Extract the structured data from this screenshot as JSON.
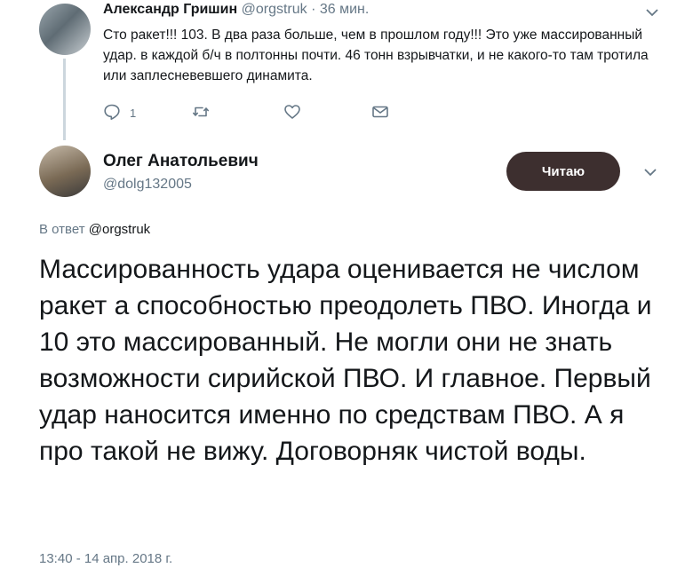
{
  "tweet1": {
    "author_name": "Александр Гришин",
    "handle": "@orgstruk",
    "separator": "·",
    "time_ago": "36 мин.",
    "text": "Сто ракет!!! 103. В два раза больше, чем в прошлом году!!! Это уже массированный удар. в каждой б/ч в полтонны почти. 46 тонн взрывчатки, и не какого-то там тротила или заплесневевшего динамита.",
    "reply_count": "1",
    "icons": {
      "reply": "reply-icon",
      "retweet": "retweet-icon",
      "like": "heart-icon",
      "dm": "envelope-icon",
      "menu": "chevron-down-icon"
    }
  },
  "tweet2": {
    "author_name": "Олег Анатольевич",
    "handle": "@dolg132005",
    "follow_button": "Читаю",
    "reply_prefix": "В ответ",
    "reply_handle": "@orgstruk",
    "text": "Массированность удара оценивается не числом ракет а способностью преодолеть ПВО. Иногда и 10 это массированный. Не могли они не знать возможности сирийской ПВО. И главное. Первый удар наносится именно по средствам ПВО. А я про такой не вижу. Договорняк чистой воды.",
    "timestamp": "13:40 - 14 апр. 2018 г.",
    "button_color": "#3d2f2f"
  }
}
